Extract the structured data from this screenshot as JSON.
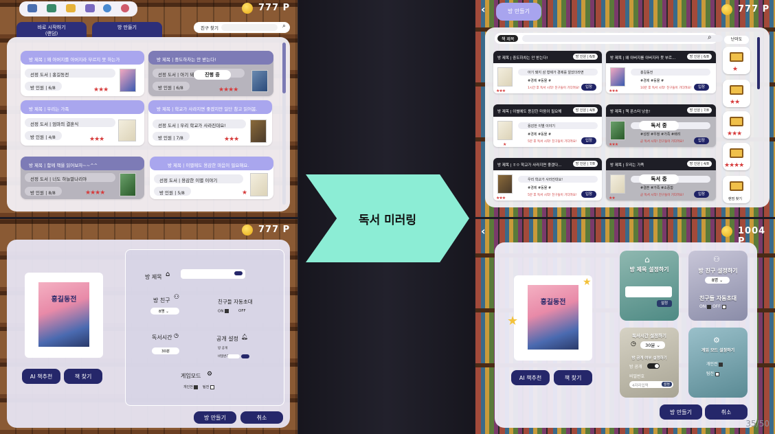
{
  "center": {
    "label": "독서 미러링"
  },
  "page_number": "35/50",
  "tl": {
    "coins": "777 P",
    "nav_icons": [
      "홈 화면",
      "서재",
      "책장",
      "설정",
      "마이페이지"
    ],
    "tabs": [
      {
        "label": "바로 시작하기\n(랜덤)"
      },
      {
        "label": "방 만들기"
      }
    ],
    "search_label": "친구 찾기",
    "cards": [
      {
        "title": "방 제목 | 왜 아버지를 아버지라 부르지 못 하는가",
        "book": "선정 도서 | 홍길동전",
        "members": "방 인원 | 6/8",
        "stars": "★★★",
        "dim": false
      },
      {
        "title": "방 제목 | 중도하차는 안 받는다!",
        "book": "선정 도서 | 아기 돼지 삼 형제",
        "members": "방 인원 | 6/8",
        "stars": "★★★★",
        "dim": true,
        "status": "진행 중"
      },
      {
        "title": "방 제목 | 우리는 가족",
        "book": "선정 도서 | 엄마의 결혼식",
        "members": "방 인원 | 4/8",
        "stars": "★★★",
        "dim": false
      },
      {
        "title": "방 제목 | 학교가 사라지면 좋겠지만 일단 참고 읽어봄.",
        "book": "선정 도서 | 우리 학교가 사라진대요!",
        "members": "방 인원 | 7/8",
        "stars": "★★★",
        "dim": false
      },
      {
        "title": "방 제목 | 함께 책을 읽어보자~~^^",
        "book": "선정 도서 | 너도 하늘말나리야",
        "members": "방 인원 | 8/8",
        "stars": "★★★★",
        "dim": true
      },
      {
        "title": "방 제목 | 이별에도 용감한 마음이 필요해요.",
        "book": "선정 도서 | 용감한 이별 이야기",
        "members": "방 인원 | 5/8",
        "stars": "★",
        "dim": false
      }
    ]
  },
  "tr": {
    "coins": "777 P",
    "title_btn": "방 만들기",
    "search_label": "책 제목",
    "difficulty_label": "난이도",
    "random_label": "랜덤 찾기",
    "side_stars": [
      "★",
      "★★",
      "★★★",
      "★★★★"
    ],
    "enter_label": "입장",
    "reading_label": "독서 중",
    "cards": [
      {
        "title": "방 제목 | 중도하차는 안 받는다!",
        "count": "방 인원 | 6/8",
        "book": "아기 돼지 삼 형제가 경제를 알았더라면",
        "tags": "#경제 #동물 #",
        "extra": "1시간 후 독서 시작! 친구들이 기다려요!",
        "stars": "★★★"
      },
      {
        "title": "방 제목 | 왜 아버지를 아버지라 못 부르...",
        "count": "방 인원 | 6/8",
        "book": "홍길동전",
        "tags": "#경제 #동물 #",
        "extra": "10분 후 독서 시작! 친구들이 기다려요!",
        "stars": "★★★"
      },
      {
        "title": "방 제목 | 이별에도 용감한 마음이 필요해",
        "count": "방 인원 | 4/8",
        "book": "용감한 이별 이야기",
        "tags": "#경제 #동물 #",
        "extra": "5분 후 독서 시작! 친구들이 기다려요!",
        "stars": "★"
      },
      {
        "title": "방 제목 | 책 폰스터 낭송!",
        "count": "방 인원 | 7/8",
        "book": "너도 하늘말나리야",
        "tags": "#성장 #우정 #가족 #배려",
        "extra": "곧 독서 시작! 친구들이 기다려요!",
        "stars": "★★★",
        "status": "독서 중"
      },
      {
        "title": "방 제목 | ㅎㅇ 학교가 사라지면 좋겠다...",
        "count": "방 인원 | 7/8",
        "book": "우리 학교가 사라진대요!",
        "tags": "#경제 #동물 #",
        "extra": "5분 후 독서 시작! 친구들이 기다려요!",
        "stars": "★★★"
      },
      {
        "title": "방 제목 | 우리는 가족",
        "count": "방 인원 | 4/8",
        "book": "엄마의 결혼식",
        "tags": "#결혼 #가족 #소중함",
        "extra": "곧 독서 시작! 친구들이 기다려요!",
        "stars": "★★",
        "status": "독서 중"
      }
    ]
  },
  "bl": {
    "coins": "777 P",
    "book_title": "홍길동전",
    "ai_btn": "AI 책추천",
    "find_btn": "책 찾기",
    "room_title": "방 제목",
    "friends": "방 친구",
    "friends_value": "8명",
    "auto_invite": "친구들 자동초대",
    "on": "ON",
    "off": "OFF",
    "read_time": "독서시간",
    "read_time_value": "30분",
    "public": "공개 설정",
    "public_opt1": "방 공개",
    "public_opt2": "비밀번호",
    "game_mode": "게임모드",
    "gm_opt1": "개인전",
    "gm_opt2": "팀전",
    "create_btn": "방 만들기",
    "cancel_btn": "취소"
  },
  "br": {
    "coins": "1004 P",
    "book_title": "홍길동전",
    "ai_btn": "AI 책추천",
    "find_btn": "책 찾기",
    "room_title_label": "방 제목 설정하기",
    "set_btn": "설정",
    "friends_label": "방 친구 설정하기",
    "friends_value": "8명",
    "auto_invite": "친구들 자동초대",
    "on": "ON",
    "off": "OFF",
    "time_label": "독서시간 설정하기",
    "time_value": "30분",
    "public_label": "방 공개 여부 설정하기",
    "public_opt": "방 공개",
    "password_label": "비밀번호",
    "password_placeholder": "4자리입력",
    "game_label": "게임 모드 설정하기",
    "gm_opt1": "개인전",
    "gm_opt2": "팀전",
    "create_btn": "방 만들기",
    "cancel_btn": "취소"
  }
}
